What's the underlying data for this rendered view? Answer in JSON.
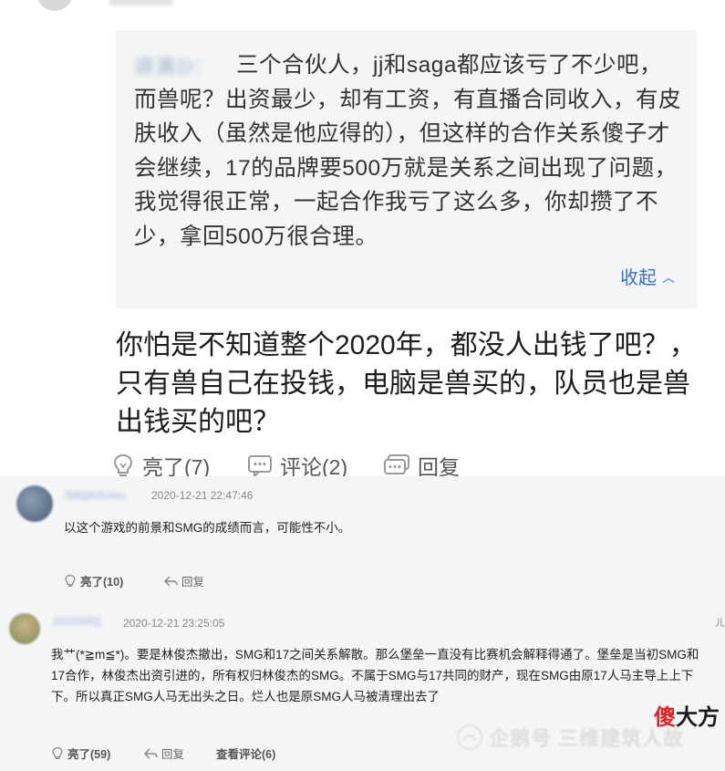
{
  "quote": {
    "text": "三个合伙人，jj和saga都应该亏了不少吧，而兽呢？出资最少，却有工资，有直播合同收入，有皮肤收入（虽然是他应得的），但这样的合作关系傻子才会继续，17的品牌要500万就是关系之间出现了问题，我觉得很正常，一起合作我亏了这么多，你却攒了不少，拿回500万很合理。",
    "collapse_label": "收起",
    "author_blurred": "讲真D："
  },
  "reply": {
    "text": "你怕是不知道整个2020年，都没人出钱了吧？，只有兽自己在投钱，电脑是兽买的，队员也是兽出钱买的吧？"
  },
  "top_actions": {
    "like_label": "亮了(7)",
    "comment_label": "评论(2)",
    "reply_label": "回复"
  },
  "comments": [
    {
      "username_blurred": "JWQAXUrec",
      "timestamp": "2020-12-21 22:47:46",
      "text": "以这个游戏的前景和SMG的成绩而言，可能性不小。",
      "like_label": "亮了(10)",
      "reply_label": "回复"
    },
    {
      "username_blurred": "GGSSRQ",
      "timestamp": "2020-12-21 23:25:05",
      "text": "我艹(*≧m≦*)。要是林俊杰撤出，SMG和17之间关系解散。那么堡垒一直没有比赛机会解释得通了。堡垒是当初SMG和17合作，林俊杰出资引进的，所有权归林俊杰的SMG。不属于SMG与17共同的财产，现在SMG由原17人马主导上上下下。所以真正SMG人马无出头之日。烂人也是原SMG人马被清理出去了",
      "like_label": "亮了(59)",
      "reply_label": "回复",
      "view_comments_label": "查看评论(6)"
    }
  ],
  "edge_mark": "ㄦ",
  "watermark": {
    "text": "企鹅号 三维建筑人故",
    "brand_1": "傻",
    "brand_2": "大方"
  },
  "colors": {
    "quote_bg": "#f4f5f7",
    "link_blue": "#3b6fc9",
    "brand_red": "#d9262b"
  }
}
